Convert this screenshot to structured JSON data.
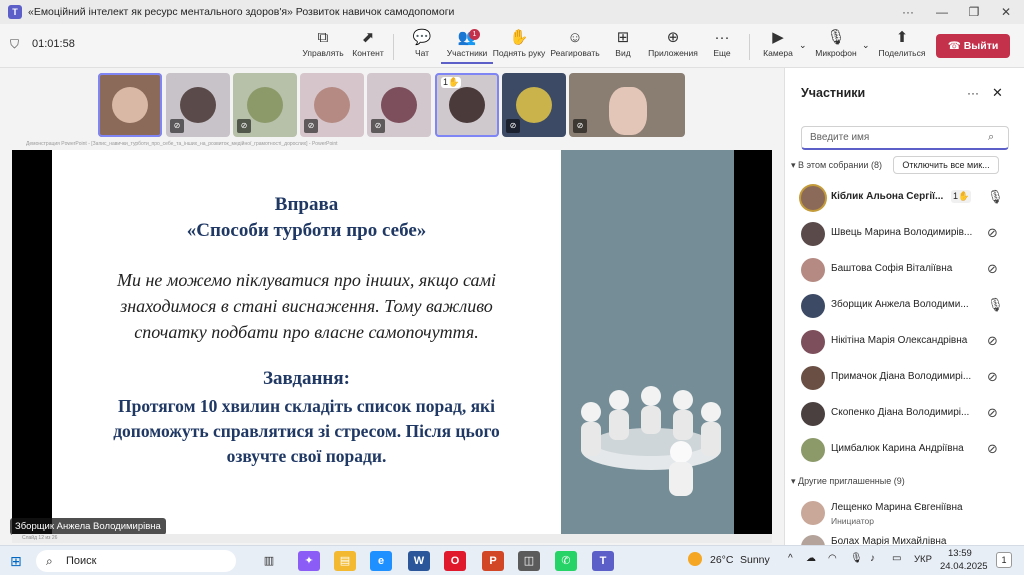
{
  "window": {
    "title": "«Емоційний інтелект як ресурс ментального здоров'я» Розвиток навичок самодопомоги"
  },
  "meeting": {
    "timer": "01:01:58"
  },
  "toolbar": {
    "buttons": [
      {
        "label": "Управлять",
        "icon": "control-icon"
      },
      {
        "label": "Контент",
        "icon": "share-content-icon"
      },
      {
        "label": "Чат",
        "icon": "chat-icon"
      },
      {
        "label": "Участники",
        "icon": "people-icon",
        "badge": "1"
      },
      {
        "label": "Поднять руку",
        "icon": "raise-hand-icon"
      },
      {
        "label": "Реагировать",
        "icon": "react-icon"
      },
      {
        "label": "Вид",
        "icon": "view-icon"
      },
      {
        "label": "Приложения",
        "icon": "apps-icon"
      },
      {
        "label": "Еще",
        "icon": "more-icon"
      }
    ],
    "camera_label": "Камера",
    "mic_label": "Микрофон",
    "share_label": "Поделиться",
    "leave_label": "Выйти"
  },
  "gallery": {
    "raised_hand_count": "1"
  },
  "slide": {
    "app_bar": "Демонстрация PowerPoint - [Запис_навички_турботи_про_себе_та_інших_на_розвиток_медійної_грамотності_дорослих] - PowerPoint",
    "title_line1": "Вправа",
    "title_line2": "«Способи турботи про себе»",
    "body_line1": "Ми не можемо піклуватися про інших, якщо самі",
    "body_line2": "знаходимося в стані виснаження. Тому важливо",
    "body_line3": "спочатку подбати про власне самопочуття.",
    "task_heading": "Завдання:",
    "task_line1": "Протягом 10 хвилин складіть список порад, які",
    "task_line2": "допоможуть справлятися зі стресом. Після цього",
    "task_line3": "озвучте свої поради.",
    "footer": "Слайд 12 из 26",
    "presenter": "Зборщик Анжела Володимирівна"
  },
  "panel": {
    "title": "Участники",
    "search_placeholder": "Введите имя",
    "in_meeting_label": "В этом собрании (8)",
    "mute_all_label": "Отключить все мик...",
    "participants": [
      {
        "name": "Кіблик Альона Сергії...",
        "hand": "1",
        "mic": "on"
      },
      {
        "name": "Швець Марина Володимирів...",
        "mic": "off"
      },
      {
        "name": "Баштова Софія Віталіївна",
        "mic": "off"
      },
      {
        "name": "Зборщик Анжела Володими...",
        "mic": "on"
      },
      {
        "name": "Нікітіна Марія Олександрівна",
        "mic": "off"
      },
      {
        "name": "Примачок Діана Володимирі...",
        "mic": "off"
      },
      {
        "name": "Скопенко Діана Володимирі...",
        "mic": "off"
      },
      {
        "name": "Цимбалюк Карина Андріївна",
        "mic": "off"
      }
    ],
    "invited_label": "Другие приглашенные (9)",
    "invited": [
      {
        "name": "Лещенко Марина Євгеніївна",
        "role": "Инициатор"
      },
      {
        "name": "Болах Марія Михайлівна"
      }
    ]
  },
  "taskbar": {
    "search_label": "Поиск",
    "weather_temp": "26°C",
    "weather_text": "Sunny",
    "lang": "УКР",
    "time": "13:59",
    "date": "24.04.2025",
    "notif": "1"
  },
  "colors": {
    "accent": "#5b5fc7",
    "leave": "#c4314b",
    "slide_title": "#1f3864",
    "slide_panel": "#748d96"
  }
}
